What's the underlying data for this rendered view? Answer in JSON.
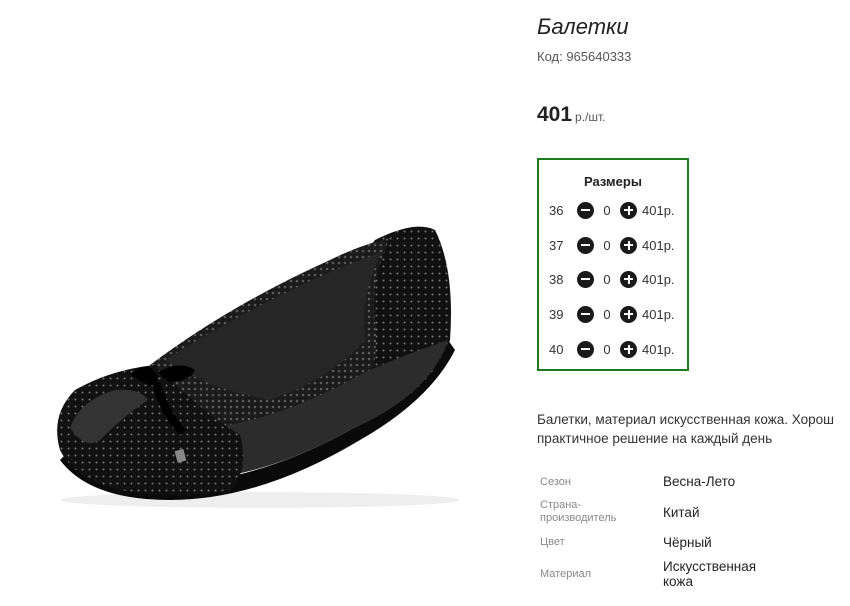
{
  "product": {
    "title": "Балетки",
    "code": "Код: 965640333",
    "price": "401",
    "price_unit": "р./шт."
  },
  "sizes": {
    "title": "Размеры",
    "rows": [
      {
        "size": "36",
        "qty": "0",
        "price": "401р."
      },
      {
        "size": "37",
        "qty": "0",
        "price": "401р."
      },
      {
        "size": "38",
        "qty": "0",
        "price": "401р."
      },
      {
        "size": "39",
        "qty": "0",
        "price": "401р."
      },
      {
        "size": "40",
        "qty": "0",
        "price": "401р."
      }
    ]
  },
  "description": {
    "line1": "Балетки, материал искусственная кожа. Хорош",
    "line2": "практичное решение на каждый день"
  },
  "attributes": [
    {
      "label": "Сезон",
      "value": "Весна-Лето"
    },
    {
      "label": "Страна-\nпроизводитель",
      "value": "Китай"
    },
    {
      "label": "Цвет",
      "value": "Чёрный"
    },
    {
      "label": "Материал",
      "value": "Искусственная\nкожа"
    }
  ],
  "colors": {
    "box_border": "#1f7a1f",
    "shoe": "#141414"
  },
  "icons": {
    "minus": "minus-circle-icon",
    "plus": "plus-circle-icon"
  }
}
